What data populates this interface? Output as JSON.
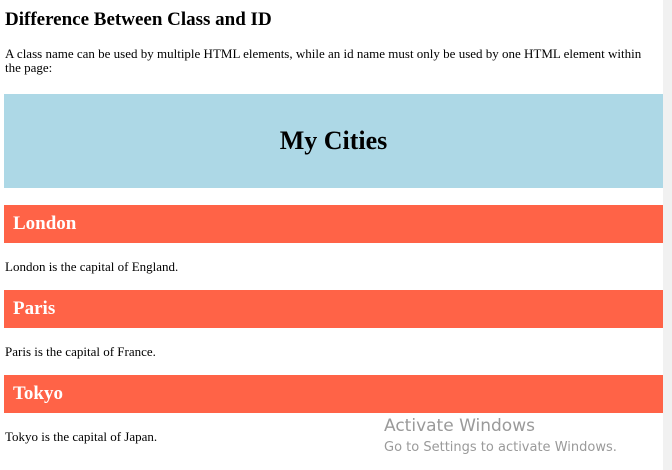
{
  "page": {
    "title": "Difference Between Class and ID",
    "intro": "A class name can be used by multiple HTML elements, while an id name must only be used by one HTML element within the page:"
  },
  "banner": {
    "title": "My Cities",
    "color": "#add8e6"
  },
  "city_color": "#ff6347",
  "cities": [
    {
      "name": "London",
      "description": "London is the capital of England."
    },
    {
      "name": "Paris",
      "description": "Paris is the capital of France."
    },
    {
      "name": "Tokyo",
      "description": "Tokyo is the capital of Japan."
    }
  ],
  "watermark": {
    "title": "Activate Windows",
    "subtitle": "Go to Settings to activate Windows.",
    "color": "#9a9a9a"
  },
  "scrollbar_color": "#f1f1f1"
}
